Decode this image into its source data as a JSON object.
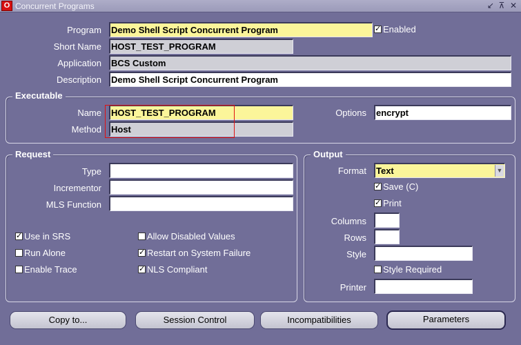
{
  "window": {
    "app_icon_glyph": "O",
    "title": "Concurrent Programs",
    "controls": [
      "↙",
      "⊼",
      "✕"
    ]
  },
  "program": {
    "program_label": "Program",
    "program_value": "Demo Shell Script  Concurrent Program",
    "enabled_label": "Enabled",
    "enabled_checked": "✓",
    "short_name_label": "Short Name",
    "short_name_value": "HOST_TEST_PROGRAM",
    "application_label": "Application",
    "application_value": "BCS Custom",
    "description_label": "Description",
    "description_value": "Demo Shell Script  Concurrent Program"
  },
  "executable": {
    "title": "Executable",
    "name_label": "Name",
    "name_value": "HOST_TEST_PROGRAM",
    "method_label": "Method",
    "method_value": "Host",
    "options_label": "Options",
    "options_value": "encrypt"
  },
  "request": {
    "title": "Request",
    "type_label": "Type",
    "type_value": "",
    "incrementor_label": "Incrementor",
    "incrementor_value": "",
    "mls_label": "MLS Function",
    "mls_value": "",
    "checkboxes": [
      {
        "label": "Use in SRS",
        "mark": "✓"
      },
      {
        "label": "Run Alone",
        "mark": ""
      },
      {
        "label": "Enable Trace",
        "mark": ""
      },
      {
        "label": "Allow Disabled Values",
        "mark": ""
      },
      {
        "label": "Restart on System Failure",
        "mark": "✓"
      },
      {
        "label": "NLS Compliant",
        "mark": "✓"
      }
    ]
  },
  "output": {
    "title": "Output",
    "format_label": "Format",
    "format_value": "Text",
    "save_label": "Save (C)",
    "save_mark": "✓",
    "print_label": "Print",
    "print_mark": "✓",
    "columns_label": "Columns",
    "columns_value": "",
    "rows_label": "Rows",
    "rows_value": "",
    "style_label": "Style",
    "style_value": "",
    "style_required_label": "Style Required",
    "style_required_mark": "",
    "printer_label": "Printer",
    "printer_value": ""
  },
  "buttons": {
    "copy_to": "Copy to...",
    "session_control": "Session Control",
    "incompatibilities": "Incompatibilities",
    "parameters": "Parameters"
  },
  "colors": {
    "background": "#716e98",
    "required_field": "#fbf59a",
    "readonly_field": "#cfcfd6",
    "focus_highlight": "#e01010"
  }
}
